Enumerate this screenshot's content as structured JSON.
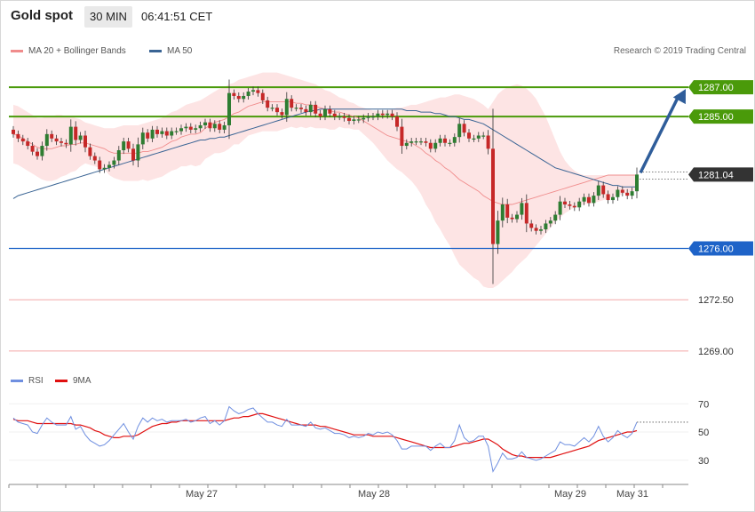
{
  "header": {
    "symbol": "Gold spot",
    "interval": "30 MIN",
    "time": "06:41:51 CET"
  },
  "legend": {
    "ma20_bb": "MA 20 + Bollinger Bands",
    "ma50": "MA 50",
    "rsi": "RSI",
    "rsi_ma": "9MA"
  },
  "copyright": "Research © 2019 Trading Central",
  "colors": {
    "bollinger_fill": "#fde4e4",
    "ma20": "#f08c8c",
    "ma50": "#3a6494",
    "candle_up": "#2e7d32",
    "candle_down": "#c62828",
    "resistance": "#4a9a0a",
    "pivot": "#1e63c8",
    "support": "#f4a8a8",
    "arrow": "#2f5d9a",
    "rsi": "#6f8fe0",
    "rsi_ma": "#e01010"
  },
  "chart_data": [
    {
      "type": "line",
      "title": "Gold spot 30 MIN",
      "x_ticks": [
        "May 27",
        "May 28",
        "May 29",
        "May 31"
      ],
      "y_range": [
        1267.6,
        1288.4
      ],
      "levels": [
        {
          "value": 1287.0,
          "label": "1287.00",
          "kind": "resistance"
        },
        {
          "value": 1285.0,
          "label": "1285.00",
          "kind": "resistance"
        },
        {
          "value": 1281.04,
          "label": "1281.04",
          "kind": "last"
        },
        {
          "value": 1276.0,
          "label": "1276.00",
          "kind": "pivot"
        },
        {
          "value": 1272.5,
          "label": "1272.50",
          "kind": "support"
        },
        {
          "value": 1269.0,
          "label": "1269.00",
          "kind": "support"
        }
      ],
      "close": [
        1283.8,
        1283.5,
        1283.3,
        1283.0,
        1282.6,
        1282.3,
        1283.0,
        1283.8,
        1283.5,
        1283.3,
        1283.2,
        1283.1,
        1284.3,
        1283.4,
        1283.7,
        1282.9,
        1282.3,
        1282.0,
        1281.4,
        1281.5,
        1281.7,
        1282.0,
        1282.7,
        1283.3,
        1282.8,
        1282.0,
        1283.1,
        1283.9,
        1283.5,
        1284.1,
        1283.8,
        1284.0,
        1283.7,
        1284.0,
        1284.0,
        1284.2,
        1284.3,
        1284.1,
        1284.2,
        1284.4,
        1284.6,
        1284.2,
        1284.5,
        1284.1,
        1284.4,
        1286.6,
        1286.4,
        1286.2,
        1286.4,
        1286.7,
        1286.8,
        1286.6,
        1286.1,
        1285.6,
        1285.6,
        1285.3,
        1285.1,
        1286.2,
        1285.6,
        1285.6,
        1285.5,
        1285.3,
        1285.8,
        1285.2,
        1285.0,
        1285.5,
        1285.2,
        1285.0,
        1285.0,
        1284.9,
        1284.7,
        1284.8,
        1284.8,
        1284.9,
        1285.0,
        1285.0,
        1285.2,
        1285.1,
        1285.2,
        1285.0,
        1284.3,
        1283.0,
        1283.2,
        1283.3,
        1283.3,
        1283.3,
        1283.2,
        1282.8,
        1283.2,
        1283.5,
        1283.2,
        1283.2,
        1283.6,
        1284.5,
        1283.9,
        1283.5,
        1283.5,
        1283.7,
        1283.7,
        1282.8,
        1276.3,
        1277.9,
        1279.0,
        1278.1,
        1278.0,
        1278.3,
        1279.1,
        1277.7,
        1277.4,
        1277.2,
        1277.3,
        1277.7,
        1277.9,
        1278.3,
        1279.2,
        1279.0,
        1278.9,
        1278.8,
        1279.2,
        1279.5,
        1279.1,
        1279.6,
        1280.3,
        1279.7,
        1279.3,
        1279.5,
        1280.0,
        1279.8,
        1279.6,
        1279.9,
        1281.04
      ],
      "series": [
        {
          "name": "MA 20",
          "values": [
            1283.8,
            1283.7,
            1283.5,
            1283.3,
            1283.1,
            1282.9,
            1282.8,
            1282.8,
            1282.8,
            1282.9,
            1283.0,
            1283.0,
            1283.1,
            1283.1,
            1283.2,
            1283.2,
            1283.1,
            1283.0,
            1282.9,
            1282.8,
            1282.6,
            1282.5,
            1282.5,
            1282.5,
            1282.5,
            1282.5,
            1282.5,
            1282.6,
            1282.6,
            1282.7,
            1282.8,
            1282.9,
            1283.1,
            1283.3,
            1283.4,
            1283.6,
            1283.7,
            1283.8,
            1283.8,
            1283.9,
            1284.2,
            1284.4,
            1284.6,
            1284.7,
            1284.8,
            1285.0,
            1285.2,
            1285.3,
            1285.5,
            1285.7,
            1285.8,
            1285.9,
            1286.0,
            1286.0,
            1286.0,
            1286.0,
            1286.0,
            1286.0,
            1286.0,
            1285.9,
            1285.9,
            1285.8,
            1285.8,
            1285.7,
            1285.6,
            1285.5,
            1285.4,
            1285.3,
            1285.3,
            1285.2,
            1285.1,
            1285.0,
            1284.9,
            1284.7,
            1284.5,
            1284.3,
            1284.1,
            1283.9,
            1283.7,
            1283.6,
            1283.5,
            1283.4,
            1283.3,
            1283.2,
            1283.0,
            1282.8,
            1282.5,
            1282.3,
            1282.0,
            1281.8,
            1281.5,
            1281.3,
            1281.0,
            1280.7,
            1280.5,
            1280.3,
            1280.1,
            1279.9,
            1279.6,
            1279.4,
            1279.2,
            1279.1,
            1279.0,
            1279.0,
            1279.0,
            1279.1,
            1279.2,
            1279.3,
            1279.4,
            1279.5,
            1279.6,
            1279.7,
            1279.8,
            1279.9,
            1280.0,
            1280.1,
            1280.2,
            1280.3,
            1280.4,
            1280.5,
            1280.6,
            1280.7,
            1280.8,
            1280.9,
            1281.0,
            1281.0,
            1281.0,
            1281.0,
            1281.0,
            1281.0,
            1281.0
          ]
        },
        {
          "name": "MA 50",
          "values": [
            1279.4,
            1279.6,
            1279.7,
            1279.8,
            1279.9,
            1280.0,
            1280.1,
            1280.2,
            1280.3,
            1280.4,
            1280.5,
            1280.6,
            1280.7,
            1280.8,
            1280.9,
            1281.0,
            1281.1,
            1281.2,
            1281.3,
            1281.4,
            1281.5,
            1281.6,
            1281.7,
            1281.8,
            1281.9,
            1282.0,
            1282.1,
            1282.2,
            1282.3,
            1282.4,
            1282.5,
            1282.6,
            1282.7,
            1282.8,
            1282.9,
            1283.0,
            1283.1,
            1283.2,
            1283.3,
            1283.4,
            1283.4,
            1283.5,
            1283.5,
            1283.6,
            1283.6,
            1283.7,
            1283.8,
            1283.9,
            1284.0,
            1284.1,
            1284.2,
            1284.3,
            1284.4,
            1284.5,
            1284.6,
            1284.7,
            1284.8,
            1284.9,
            1285.0,
            1285.1,
            1285.2,
            1285.3,
            1285.4,
            1285.4,
            1285.5,
            1285.5,
            1285.5,
            1285.5,
            1285.5,
            1285.5,
            1285.5,
            1285.5,
            1285.5,
            1285.5,
            1285.5,
            1285.5,
            1285.5,
            1285.5,
            1285.5,
            1285.5,
            1285.5,
            1285.5,
            1285.4,
            1285.4,
            1285.4,
            1285.3,
            1285.3,
            1285.3,
            1285.2,
            1285.2,
            1285.1,
            1285.0,
            1285.0,
            1284.9,
            1284.8,
            1284.8,
            1284.7,
            1284.6,
            1284.5,
            1284.3,
            1284.1,
            1283.9,
            1283.7,
            1283.5,
            1283.3,
            1283.1,
            1282.9,
            1282.7,
            1282.5,
            1282.3,
            1282.1,
            1281.9,
            1281.7,
            1281.5,
            1281.4,
            1281.3,
            1281.2,
            1281.1,
            1281.0,
            1280.9,
            1280.8,
            1280.7,
            1280.6,
            1280.5,
            1280.4,
            1280.3,
            1280.3,
            1280.2,
            1280.2,
            1280.2,
            1280.2
          ]
        }
      ],
      "bb_upper": [
        1285.8,
        1285.7,
        1285.5,
        1285.3,
        1285.1,
        1284.9,
        1284.9,
        1285.0,
        1285.0,
        1285.1,
        1285.1,
        1285.0,
        1285.0,
        1284.9,
        1284.8,
        1284.6,
        1284.5,
        1284.4,
        1284.3,
        1284.2,
        1284.2,
        1284.2,
        1284.3,
        1284.4,
        1284.4,
        1284.4,
        1284.4,
        1284.5,
        1284.6,
        1284.7,
        1284.8,
        1284.9,
        1285.1,
        1285.3,
        1285.4,
        1285.6,
        1285.8,
        1285.9,
        1286.0,
        1286.1,
        1286.3,
        1286.5,
        1286.7,
        1286.9,
        1287.0,
        1287.2,
        1287.3,
        1287.5,
        1287.6,
        1287.7,
        1287.8,
        1287.9,
        1288.0,
        1288.0,
        1288.0,
        1288.0,
        1287.9,
        1287.8,
        1287.7,
        1287.6,
        1287.5,
        1287.4,
        1287.3,
        1287.2,
        1287.0,
        1286.8,
        1286.7,
        1286.5,
        1286.3,
        1286.2,
        1286.0,
        1285.9,
        1285.7,
        1285.6,
        1285.5,
        1285.4,
        1285.4,
        1285.4,
        1285.4,
        1285.5,
        1285.6,
        1285.6,
        1285.7,
        1285.8,
        1285.8,
        1285.9,
        1286.0,
        1286.1,
        1286.2,
        1286.3,
        1286.3,
        1286.4,
        1286.5,
        1286.5,
        1286.4,
        1286.3,
        1286.2,
        1286.0,
        1285.8,
        1285.5,
        1286.0,
        1286.5,
        1286.8,
        1287.0,
        1287.1,
        1287.2,
        1287.1,
        1286.9,
        1286.6,
        1286.2,
        1285.6,
        1285.0,
        1284.2,
        1283.4,
        1282.6,
        1282.0,
        1281.6,
        1281.3,
        1281.1,
        1281.0,
        1281.0,
        1281.0,
        1281.0,
        1281.0,
        1281.0,
        1281.0,
        1281.0,
        1281.0,
        1281.0,
        1281.0,
        1281.0
      ],
      "bb_lower": [
        1281.8,
        1281.7,
        1281.5,
        1281.3,
        1281.1,
        1280.9,
        1280.7,
        1280.6,
        1280.6,
        1280.7,
        1280.9,
        1281.0,
        1281.2,
        1281.3,
        1281.6,
        1281.8,
        1281.7,
        1281.6,
        1281.5,
        1281.4,
        1281.0,
        1280.8,
        1280.7,
        1280.6,
        1280.6,
        1280.6,
        1280.6,
        1280.7,
        1280.6,
        1280.7,
        1280.8,
        1280.9,
        1281.1,
        1281.3,
        1281.4,
        1281.6,
        1281.6,
        1281.7,
        1281.6,
        1281.7,
        1282.1,
        1282.3,
        1282.5,
        1282.5,
        1282.6,
        1282.8,
        1283.1,
        1283.1,
        1283.4,
        1283.7,
        1283.8,
        1283.9,
        1284.0,
        1284.0,
        1284.0,
        1284.0,
        1284.1,
        1284.2,
        1284.3,
        1284.2,
        1284.3,
        1284.2,
        1284.3,
        1284.2,
        1284.2,
        1284.2,
        1284.1,
        1284.1,
        1284.3,
        1284.2,
        1284.2,
        1284.1,
        1284.1,
        1283.8,
        1283.5,
        1283.2,
        1282.8,
        1282.4,
        1282.0,
        1281.7,
        1281.4,
        1281.2,
        1280.9,
        1280.6,
        1280.2,
        1279.7,
        1279.0,
        1278.5,
        1277.8,
        1277.3,
        1276.7,
        1276.2,
        1275.5,
        1274.9,
        1274.6,
        1274.3,
        1274.0,
        1273.8,
        1273.4,
        1273.3,
        1273.3,
        1273.5,
        1273.8,
        1274.1,
        1274.4,
        1274.8,
        1275.1,
        1275.4,
        1275.8,
        1276.2,
        1276.6,
        1277.0,
        1277.4,
        1277.8,
        1278.1,
        1278.4,
        1278.6,
        1278.8,
        1278.9,
        1279.0,
        1279.1,
        1279.1,
        1279.2,
        1279.3,
        1279.4,
        1279.5,
        1279.6,
        1279.7,
        1279.8,
        1279.9,
        1280.0
      ],
      "forecast": {
        "from": 1281.04,
        "to": 1287.0
      }
    },
    {
      "type": "line",
      "title": "RSI",
      "y_ticks": [
        70,
        50,
        30
      ],
      "y_range": [
        16,
        79
      ],
      "series": [
        {
          "name": "RSI",
          "values": [
            60,
            57,
            56,
            55,
            50,
            49,
            55,
            60,
            57,
            55,
            55,
            55,
            61,
            52,
            54,
            48,
            44,
            42,
            40,
            41,
            44,
            48,
            52,
            56,
            50,
            45,
            54,
            60,
            57,
            60,
            58,
            59,
            57,
            58,
            58,
            58,
            59,
            57,
            58,
            60,
            61,
            56,
            58,
            55,
            58,
            68,
            65,
            63,
            64,
            66,
            67,
            63,
            60,
            57,
            57,
            55,
            54,
            59,
            55,
            55,
            55,
            54,
            57,
            53,
            52,
            53,
            51,
            49,
            49,
            48,
            46,
            47,
            46,
            47,
            49,
            48,
            50,
            49,
            50,
            48,
            44,
            38,
            38,
            40,
            40,
            40,
            40,
            37,
            40,
            42,
            39,
            39,
            44,
            55,
            46,
            43,
            44,
            47,
            47,
            40,
            22,
            28,
            35,
            31,
            31,
            32,
            36,
            32,
            31,
            30,
            31,
            33,
            35,
            37,
            43,
            41,
            41,
            40,
            43,
            46,
            43,
            47,
            54,
            47,
            43,
            46,
            51,
            48,
            46,
            49,
            57
          ]
        },
        {
          "name": "9MA",
          "values": [
            59,
            58,
            58,
            58,
            57,
            56,
            56,
            56,
            56,
            56,
            56,
            56,
            56,
            55,
            55,
            54,
            53,
            51,
            50,
            48,
            47,
            46,
            46,
            47,
            47,
            47,
            48,
            50,
            52,
            54,
            55,
            56,
            56,
            57,
            57,
            58,
            58,
            58,
            58,
            58,
            58,
            58,
            58,
            58,
            58,
            59,
            60,
            60,
            61,
            61,
            62,
            63,
            63,
            62,
            61,
            60,
            59,
            58,
            57,
            56,
            55,
            55,
            55,
            55,
            54,
            54,
            53,
            52,
            51,
            50,
            49,
            48,
            48,
            48,
            48,
            47,
            47,
            47,
            47,
            47,
            46,
            45,
            44,
            43,
            42,
            41,
            40,
            39,
            39,
            39,
            39,
            39,
            40,
            41,
            42,
            42,
            43,
            44,
            45,
            45,
            43,
            41,
            38,
            36,
            34,
            33,
            33,
            32,
            32,
            32,
            32,
            32,
            32,
            33,
            34,
            35,
            36,
            37,
            38,
            39,
            40,
            42,
            44,
            45,
            46,
            47,
            48,
            49,
            50,
            50,
            51
          ]
        }
      ]
    }
  ]
}
